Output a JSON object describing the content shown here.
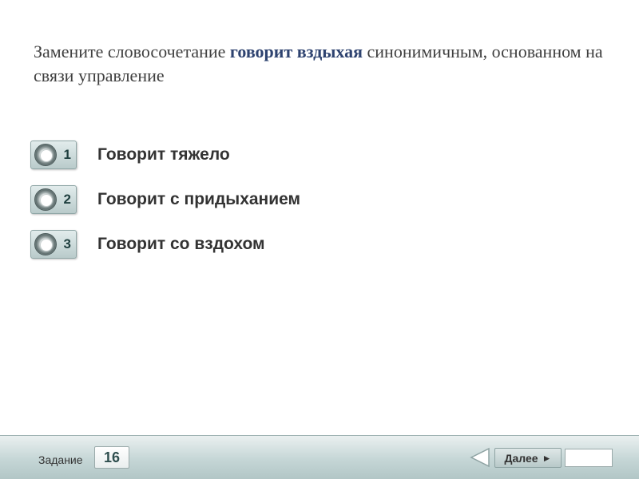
{
  "question": {
    "before": "Замените словосочетание ",
    "highlight": "говорит вздыхая",
    "after": " синонимичным, основанном на связи управление"
  },
  "options": [
    {
      "number": "1",
      "text": "Говорит тяжело"
    },
    {
      "number": "2",
      "text": "Говорит с придыханием"
    },
    {
      "number": "3",
      "text": "Говорит со вздохом"
    }
  ],
  "footer": {
    "task_label": "Задание",
    "task_number": "16",
    "next_label": "Далее",
    "next_arrow": "►"
  },
  "colors": {
    "highlight": "#2e4370",
    "footer_bg": "#c5d6d6"
  }
}
